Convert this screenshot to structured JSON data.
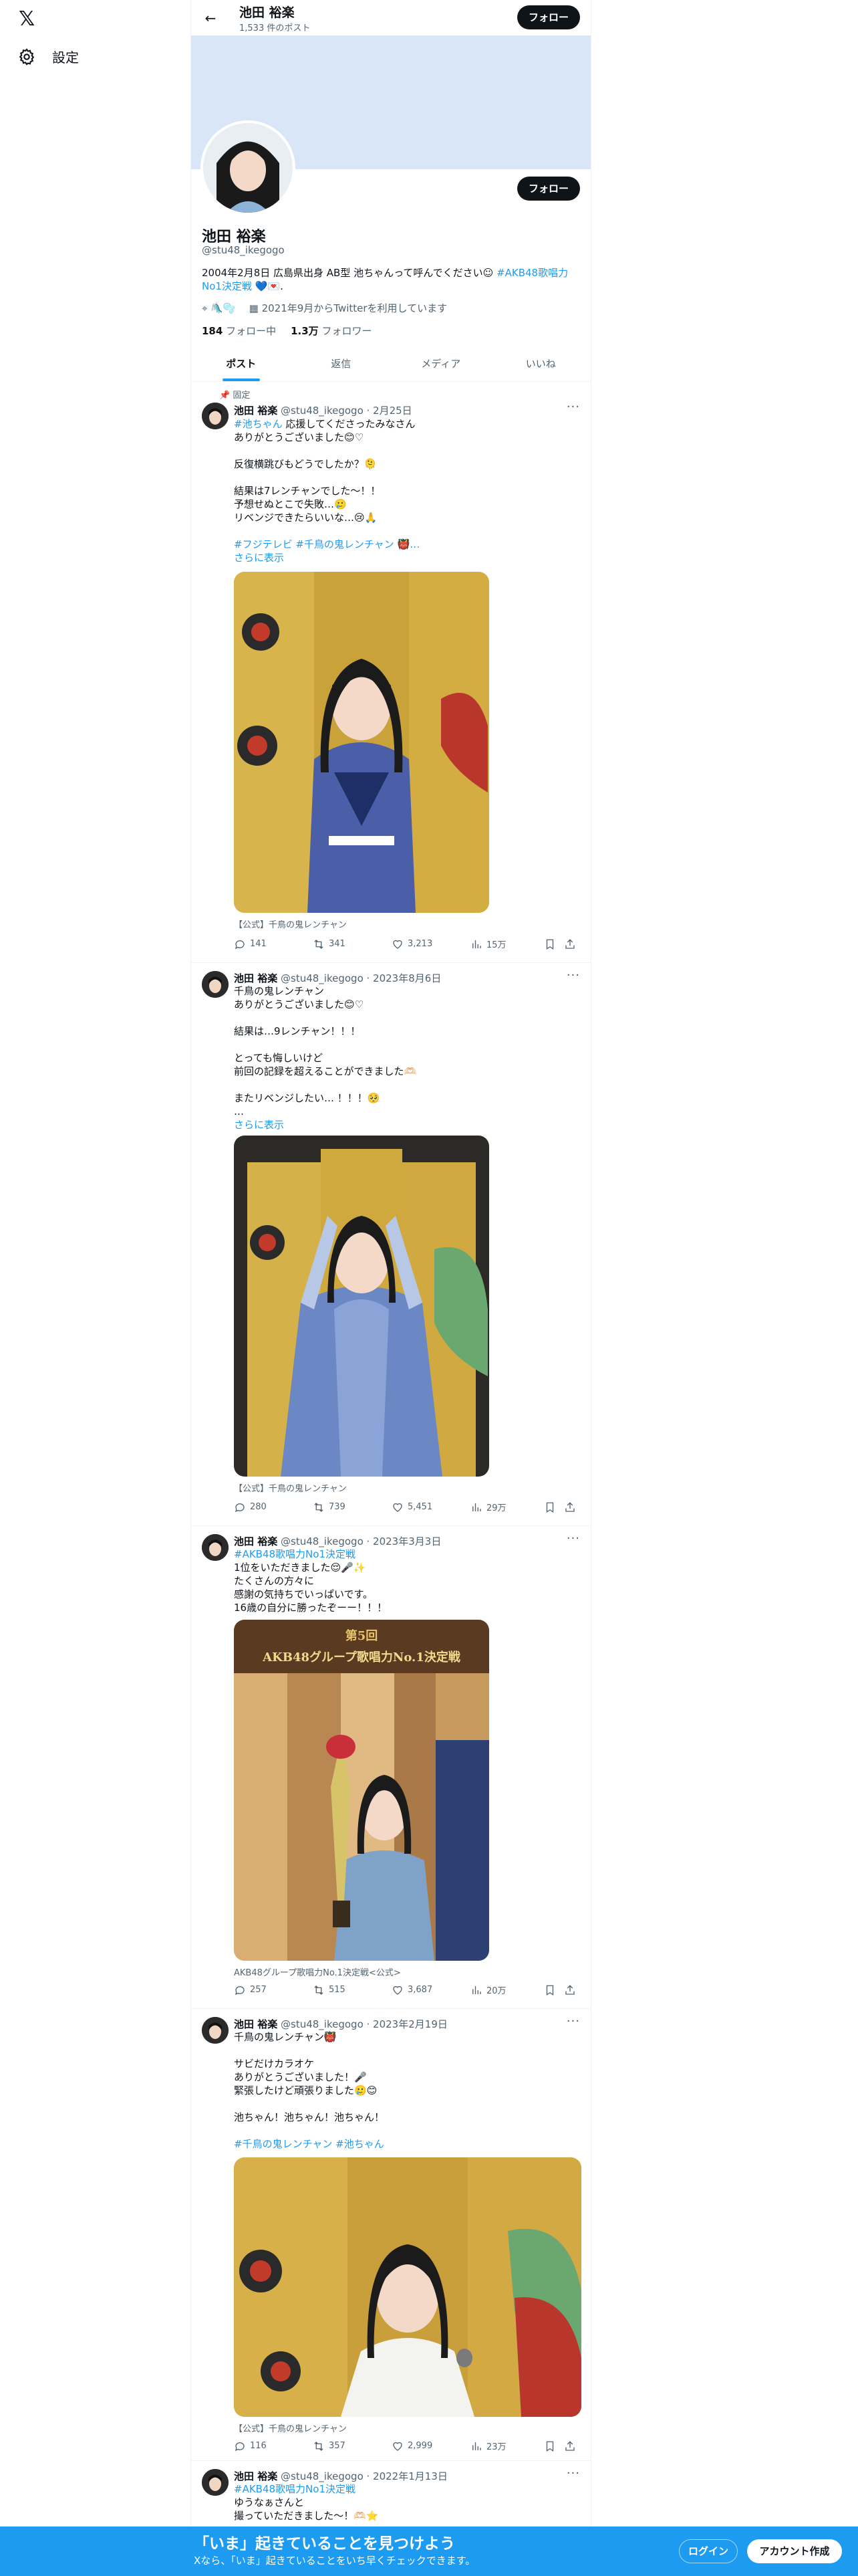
{
  "nav": {
    "logo": "𝕏",
    "settings_label": "設定"
  },
  "topbar": {
    "name": "池田 裕楽",
    "post_count": "1,533 件のポスト",
    "follow_label": "フォロー"
  },
  "profile": {
    "name": "池田 裕楽",
    "handle": "@stu48_ikegogo",
    "follow_label": "フォロー",
    "bio_text": "2004年2月8日 広島県出身 AB型 池ちゃんって呼んでください☺︎ ",
    "bio_tag": "#AKB48歌唱力No1決定戦",
    "bio_end": " 💙💌.",
    "location": "🛝🫧",
    "joined": "2021年9月からTwitterを利用しています",
    "following_count": "184",
    "following_label": "フォロー中",
    "followers_count": "1.3万",
    "followers_label": "フォロワー"
  },
  "tabs": [
    "ポスト",
    "返信",
    "メディア",
    "いいね"
  ],
  "posts": [
    {
      "pinned": "固定",
      "name": "池田 裕楽",
      "handle": "@stu48_ikegogo · 2月25日",
      "tag1": "#池ちゃん",
      "line1": " 応援してくださったみなさん",
      "rest": "ありがとうございました😊♡\n\n反復横跳びもどうでしたか？🫠\n\n結果は7レンチャンでした〜！！\n予想せぬとこで失敗…🥲\nリベンジできたらいいな…😢🙏",
      "tags2": "#フジテレビ #千鳥の鬼レンチャン 👹…",
      "showmore": "さらに表示",
      "caption": "【公式】千鳥の鬼レンチャン",
      "replies": "141",
      "reposts": "341",
      "likes": "3,213",
      "views": "15万"
    },
    {
      "name": "池田 裕楽",
      "handle": "@stu48_ikegogo · 2023年8月6日",
      "text": "千鳥の鬼レンチャン\nありがとうございました😊♡\n\n結果は…9レンチャン！！！\n\nとっても悔しいけど\n前回の記録を超えることができました🫶🏻\n\nまたリベンジしたい… ！！！🥺\n…",
      "showmore": "さらに表示",
      "caption": "【公式】千鳥の鬼レンチャン",
      "replies": "280",
      "reposts": "739",
      "likes": "5,451",
      "views": "29万"
    },
    {
      "name": "池田 裕楽",
      "handle": "@stu48_ikegogo · 2023年3月3日",
      "tag1": "#AKB48歌唱力No1決定戦",
      "text": "1位をいただきました😌🎤✨\nたくさんの方々に\n感謝の気持ちでいっぱいです。\n16歳の自分に勝ったぞーー！！！",
      "banner_title1": "第5回",
      "banner_title2": "AKB48グループ歌唱力No.1決定戦",
      "caption": "AKB48グループ歌唱力No.1決定戦<公式>",
      "replies": "257",
      "reposts": "515",
      "likes": "3,687",
      "views": "20万"
    },
    {
      "name": "池田 裕楽",
      "handle": "@stu48_ikegogo · 2023年2月19日",
      "text": "千鳥の鬼レンチャン👹\n\nサビだけカラオケ\nありがとうございました！🎤\n緊張したけど頑張りました🥲😊\n\n池ちゃん！池ちゃん！池ちゃん！",
      "tags2": "#千鳥の鬼レンチャン #池ちゃん",
      "caption": "【公式】千鳥の鬼レンチャン",
      "replies": "116",
      "reposts": "357",
      "likes": "2,999",
      "views": "23万"
    },
    {
      "name": "池田 裕楽",
      "handle": "@stu48_ikegogo · 2022年1月13日",
      "tag1": "#AKB48歌唱力No1決定戦",
      "text": "ゆうなぁさんと\n撮っていただきました〜！🫶🏻⭐️"
    }
  ],
  "bottom": {
    "title": "「いま」起きていることを見つけよう",
    "subtitle": "Xなら、「いま」起きていることをいち早くチェックできます。",
    "login": "ログイン",
    "signup": "アカウント作成"
  }
}
